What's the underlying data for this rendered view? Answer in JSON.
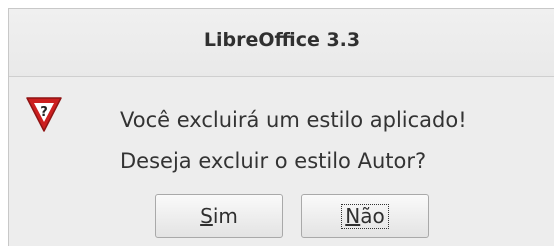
{
  "window": {
    "title": "LibreOffice 3.3"
  },
  "dialog": {
    "icon": "warning-question-icon",
    "message_line1": "Você excluirá um estilo aplicado!",
    "message_line2": "Deseja excluir o estilo Autor?",
    "buttons": {
      "yes": {
        "mnemonic": "S",
        "rest": "im"
      },
      "no": {
        "mnemonic": "N",
        "rest": "ão",
        "focused": true
      }
    }
  },
  "colors": {
    "dialog_bg": "#ededed",
    "icon_red": "#cc1f1f",
    "text": "#333333"
  }
}
